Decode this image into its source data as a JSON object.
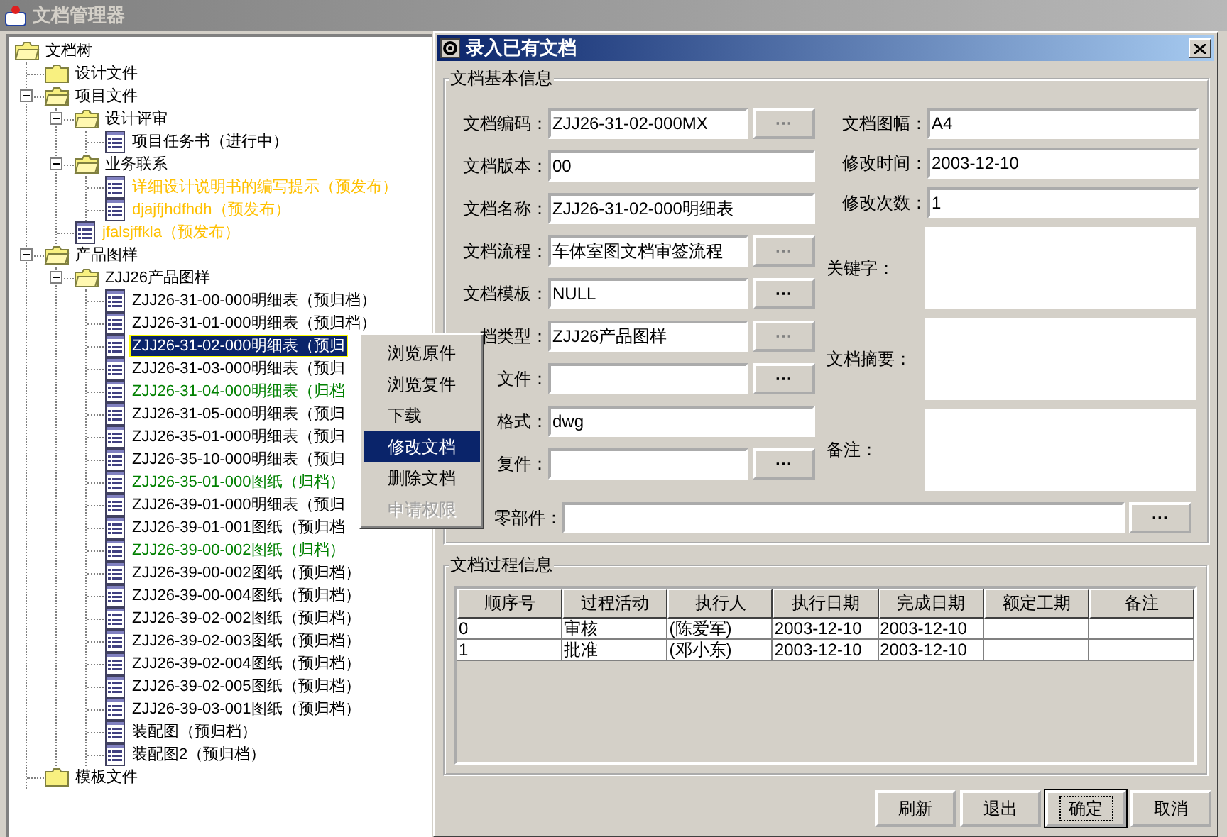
{
  "window": {
    "title": "文档管理器"
  },
  "tree": {
    "label": "文档树",
    "kind": "root",
    "children": [
      {
        "label": "设计文件",
        "kind": "folder"
      },
      {
        "label": "项目文件",
        "kind": "folder",
        "expanded": true,
        "children": [
          {
            "label": "设计评审",
            "kind": "folder",
            "expanded": true,
            "children": [
              {
                "label": "项目任务书（进行中）",
                "kind": "document",
                "color": "#000000",
                "selected": false
              }
            ]
          },
          {
            "label": "业务联系",
            "kind": "folder",
            "expanded": true,
            "children": [
              {
                "label": "详细设计说明书的编写提示（预发布）",
                "kind": "document",
                "color": "#ffc000",
                "selected": false
              },
              {
                "label": "djajfjhdfhdh（预发布）",
                "kind": "document",
                "color": "#ffc000",
                "selected": false
              }
            ]
          },
          {
            "label": "jfalsjffkla（预发布）",
            "kind": "document",
            "color": "#ffc000",
            "selected": false
          }
        ]
      },
      {
        "label": "产品图样",
        "kind": "folder",
        "expanded": true,
        "children": [
          {
            "label": "ZJJ26产品图样",
            "kind": "folder",
            "expanded": true,
            "children": [
              {
                "label": "ZJJ26-31-00-000明细表（预归档）",
                "kind": "document",
                "color": "#000000",
                "selected": false
              },
              {
                "label": "ZJJ26-31-01-000明细表（预归档）",
                "kind": "document",
                "color": "#000000",
                "selected": false
              },
              {
                "label": "ZJJ26-31-02-000明细表（预归",
                "kind": "document",
                "selected": true
              },
              {
                "label": "ZJJ26-31-03-000明细表（预归",
                "kind": "document",
                "color": "#000000",
                "selected": false
              },
              {
                "label": "ZJJ26-31-04-000明细表（归档",
                "kind": "document",
                "color": "#008000",
                "selected": false
              },
              {
                "label": "ZJJ26-31-05-000明细表（预归",
                "kind": "document",
                "color": "#000000",
                "selected": false
              },
              {
                "label": "ZJJ26-35-01-000明细表（预归",
                "kind": "document",
                "color": "#000000",
                "selected": false
              },
              {
                "label": "ZJJ26-35-10-000明细表（预归",
                "kind": "document",
                "color": "#000000",
                "selected": false
              },
              {
                "label": "ZJJ26-35-01-000图纸（归档）",
                "kind": "document",
                "color": "#008000",
                "selected": false
              },
              {
                "label": "ZJJ26-39-01-000明细表（预归",
                "kind": "document",
                "color": "#000000",
                "selected": false
              },
              {
                "label": "ZJJ26-39-01-001图纸（预归档",
                "kind": "document",
                "color": "#000000",
                "selected": false
              },
              {
                "label": "ZJJ26-39-00-002图纸（归档）",
                "kind": "document",
                "color": "#008000",
                "selected": false
              },
              {
                "label": "ZJJ26-39-00-002图纸（预归档）",
                "kind": "document",
                "color": "#000000",
                "selected": false
              },
              {
                "label": "ZJJ26-39-00-004图纸（预归档）",
                "kind": "document",
                "color": "#000000",
                "selected": false
              },
              {
                "label": "ZJJ26-39-02-002图纸（预归档）",
                "kind": "document",
                "color": "#000000",
                "selected": false
              },
              {
                "label": "ZJJ26-39-02-003图纸（预归档）",
                "kind": "document",
                "color": "#000000",
                "selected": false
              },
              {
                "label": "ZJJ26-39-02-004图纸（预归档）",
                "kind": "document",
                "color": "#000000",
                "selected": false
              },
              {
                "label": "ZJJ26-39-02-005图纸（预归档）",
                "kind": "document",
                "color": "#000000",
                "selected": false
              },
              {
                "label": "ZJJ26-39-03-001图纸（预归档）",
                "kind": "document",
                "color": "#000000",
                "selected": false
              },
              {
                "label": "装配图（预归档）",
                "kind": "document",
                "color": "#000000",
                "selected": false
              },
              {
                "label": "装配图2（预归档）",
                "kind": "document",
                "color": "#000000",
                "selected": false
              }
            ]
          }
        ]
      },
      {
        "label": "模板文件",
        "kind": "folder"
      }
    ]
  },
  "context_menu": [
    {
      "label": "浏览原件",
      "selected": false,
      "disabled": false
    },
    {
      "label": "浏览复件",
      "selected": false,
      "disabled": false
    },
    {
      "label": "下载",
      "selected": false,
      "disabled": false
    },
    {
      "label": "修改文档",
      "selected": true,
      "disabled": false
    },
    {
      "label": "删除文档",
      "selected": false,
      "disabled": false
    },
    {
      "label": "申请权限",
      "selected": false,
      "disabled": true
    }
  ],
  "dialog": {
    "title": "录入已有文档",
    "basic_info": {
      "title": "文档基本信息",
      "left_fields": [
        {
          "label": "文档编码：",
          "value": "ZJJ26-31-02-000MX",
          "browse": {
            "label": "···",
            "disabled": true
          }
        },
        {
          "label": "文档版本：",
          "value": "00"
        },
        {
          "label": "文档名称：",
          "value": "ZJJ26-31-02-000明细表"
        },
        {
          "label": "文档流程：",
          "value": "车体室图文档审签流程",
          "browse": {
            "label": "···",
            "disabled": true
          }
        },
        {
          "label": "文档模板：",
          "value": "NULL",
          "browse": {
            "label": "···",
            "disabled": false
          }
        },
        {
          "label": "档类型：",
          "value": "ZJJ26产品图样",
          "browse": {
            "label": "···",
            "disabled": true
          }
        },
        {
          "label": "文件：",
          "browse": {
            "label": "···",
            "disabled": false
          }
        },
        {
          "label": "格式：",
          "value": "dwg"
        },
        {
          "label": "复件：",
          "browse": {
            "label": "···",
            "disabled": false
          }
        }
      ],
      "right_fields": [
        {
          "label": "文档图幅：",
          "value": "A4",
          "kind": "line"
        },
        {
          "label": "修改时间：",
          "value": "2003-12-10",
          "kind": "line"
        },
        {
          "label": "修改次数：",
          "value": "1",
          "kind": "line"
        },
        {
          "label": "关键字：",
          "kind": "area"
        },
        {
          "label": "文档摘要：",
          "kind": "area"
        },
        {
          "label": "备注：",
          "kind": "area"
        }
      ],
      "parts_field": {
        "label": "零部件：",
        "browse": {
          "label": "···",
          "disabled": false
        }
      }
    },
    "process_info": {
      "title": "文档过程信息",
      "columns": [
        "顺序号",
        "过程活动",
        "执行人",
        "执行日期",
        "完成日期",
        "额定工期",
        "备注"
      ],
      "rows": [
        [
          "0",
          "审核",
          "(陈爱军)",
          "2003-12-10",
          "2003-12-10",
          "",
          ""
        ],
        [
          "1",
          "批准",
          "(邓小东)",
          "2003-12-10",
          "2003-12-10",
          "",
          ""
        ]
      ]
    },
    "buttons": [
      {
        "label": "刷新",
        "focused": false
      },
      {
        "label": "退出",
        "focused": false
      },
      {
        "label": "确定",
        "focused": true
      },
      {
        "label": "取消",
        "focused": false
      }
    ]
  }
}
